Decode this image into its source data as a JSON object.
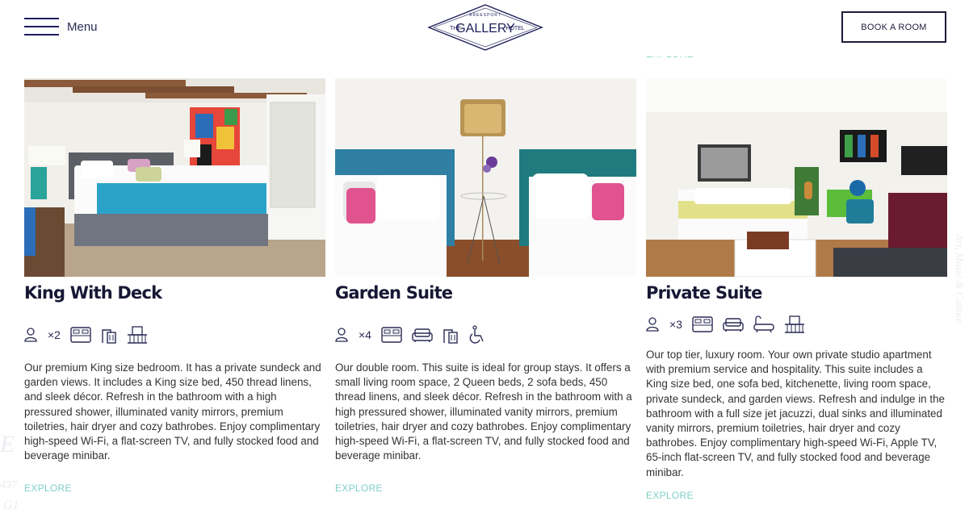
{
  "header": {
    "menu_label": "Menu",
    "book_label": "BOOK A ROOM",
    "logo": {
      "line1": "AREESPORT",
      "left": "THE",
      "main": "GALLERY",
      "right": "HOTEL"
    }
  },
  "peek_explore": "EXPLORE",
  "rooms": [
    {
      "name": "King With Deck",
      "guests": "×2",
      "amenity_icons": [
        "guest-icon",
        "king-bed-icon",
        "shower-icon",
        "balcony-icon"
      ],
      "description": "Our premium King size bedroom. It has a private sundeck and garden views. It includes a King size bed, 450 thread linens, and sleek décor. Refresh in the bathroom with a high pressured shower, illuminated vanity mirrors, premium toiletries, hair dryer and cozy bathrobes. Enjoy complimentary high-speed Wi-Fi, a flat-screen TV, and fully stocked food and beverage minibar.",
      "explore": "EXPLORE"
    },
    {
      "name": "Garden Suite",
      "guests": "×4",
      "amenity_icons": [
        "guest-icon",
        "queen-bed-icon",
        "sofa-icon",
        "shower-icon",
        "wheelchair-icon"
      ],
      "description": "Our double room. This suite is ideal for group stays. It offers a small living room space, 2 Queen beds, 2 sofa beds, 450 thread linens, and sleek décor. Refresh in the bathroom with a high pressured shower, illuminated vanity mirrors, premium toiletries, hair dryer and cozy bathrobes. Enjoy complimentary high-speed Wi-Fi, a flat-screen TV, and fully stocked food and beverage minibar.",
      "explore": "EXPLORE"
    },
    {
      "name": "Private Suite",
      "guests": "×3",
      "amenity_icons": [
        "guest-icon",
        "king-bed-icon",
        "sofa-icon",
        "bathtub-icon",
        "balcony-icon"
      ],
      "description": "Our top tier, luxury room. Your own private studio apartment with premium service and hospitality. This suite includes a King size bed, one sofa bed, kitchenette, living room space, private sundeck, and garden views. Refresh and indulge in the bathroom with a full size jet jacuzzi, dual sinks and illuminated vanity mirrors, premium toiletries, hair dryer and cozy bathrobes. Enjoy complimentary high-speed Wi-Fi, Apple TV, 65-inch flat-screen TV, and fully stocked food and beverage minibar.",
      "explore": "EXPLORE"
    }
  ],
  "colors": {
    "navy": "#1d1d3a",
    "accent": "#7fd0c6",
    "text": "#333333"
  }
}
